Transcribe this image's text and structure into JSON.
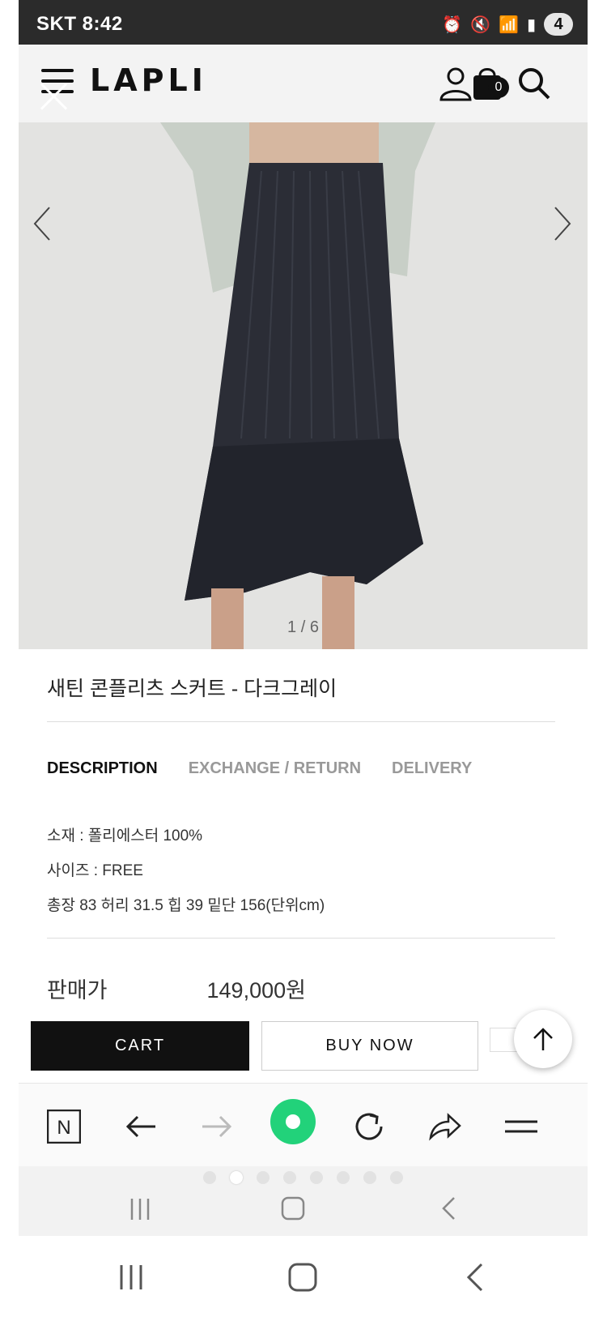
{
  "status": {
    "carrier_time": "SKT 8:42",
    "badge": "4"
  },
  "header": {
    "logo": "LAPLI",
    "cart_count": "0"
  },
  "gallery": {
    "pager": "1 / 6"
  },
  "product": {
    "title": "새틴 콘플리츠 스커트 - 다크그레이",
    "tabs": [
      "DESCRIPTION",
      "EXCHANGE / RETURN",
      "DELIVERY"
    ],
    "description": [
      "소재 : 폴리에스터 100%",
      "사이즈 : FREE",
      "총장 83 허리 31.5 힙 39 밑단 156(단위cm)"
    ],
    "price_label": "판매가",
    "price": "149,000원"
  },
  "actions": {
    "cart": "CART",
    "buy_now": "BUY NOW"
  },
  "colors": {
    "status_bar": "#2b2b2b",
    "browser_accent": "#22d27a",
    "button_dark": "#111111"
  }
}
